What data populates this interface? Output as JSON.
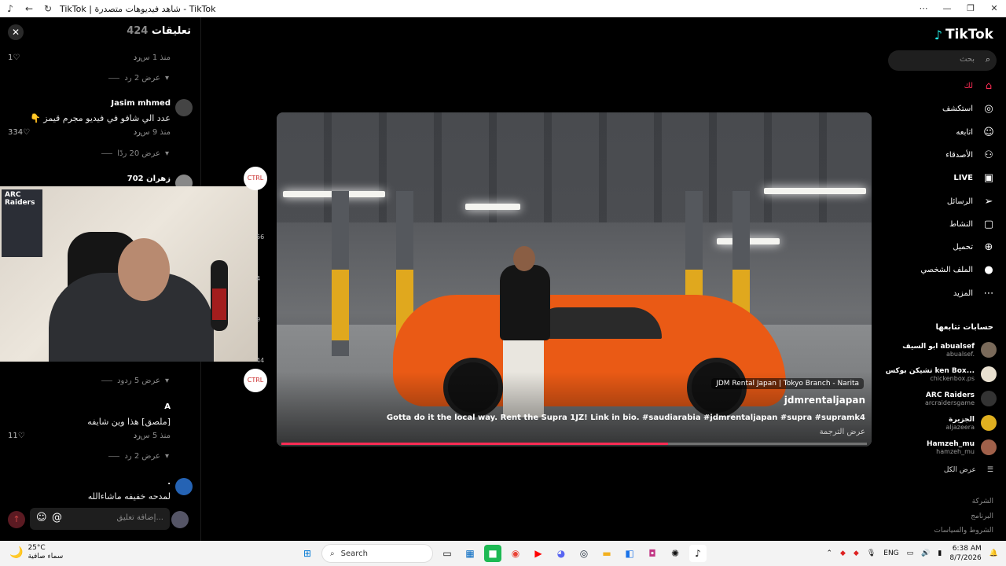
{
  "window": {
    "title": "TikTok | شاهد فيديوهات متصدرة - TikTok"
  },
  "comments": {
    "header_label": "تعليقات",
    "header_count": "424",
    "items": [
      {
        "meta": "منذ 1 س",
        "reply": "رد",
        "likes": "1"
      },
      {
        "replies_toggle": "عرض 2 رد"
      },
      {
        "name": "Jasim mhmed",
        "text": "عدد الي شافو في فيديو مجرم قيمز 👇",
        "meta": "منذ 9 س",
        "reply": "رد",
        "likes": "334"
      },
      {
        "replies_toggle": "عرض 20 ردًا"
      },
      {
        "name": "زهران 702"
      },
      {
        "replies_toggle": "عرض 5 ردود"
      },
      {
        "name": "A",
        "text": "[ملصق] هذا وين شايفه",
        "meta": "منذ 5 س",
        "reply": "رد",
        "likes": "11"
      },
      {
        "replies_toggle": "عرض 2 رد"
      },
      {
        "name": ".",
        "text": "لمدحه خفيفه ماشاءالله"
      }
    ],
    "input_placeholder": "إضافة تعليق...",
    "send_icon": "up-arrow-icon"
  },
  "webcam": {
    "poster_text": "ARC Raiders"
  },
  "side_actions": [
    "56",
    "4",
    "9",
    "44"
  ],
  "video": {
    "brand_tag": "JDM Rental Japan | Tokyo Branch - Narita",
    "author": "jdmrentaljapan",
    "description": "Gotta do it the local way. Rent the Supra 1JZ! Link in bio. #saudiarabia #jdmrentaljapan #supra #supramk4",
    "translate": "عرض الترجمة",
    "progress": 0.66
  },
  "nav": {
    "logo": "TikTok",
    "search_placeholder": "بحث",
    "items": [
      {
        "label": "لك",
        "icon": "home-icon",
        "active": true
      },
      {
        "label": "استكشف",
        "icon": "compass-icon"
      },
      {
        "label": "اتابعه",
        "icon": "user-follow-icon"
      },
      {
        "label": "الأصدقاء",
        "icon": "friends-icon"
      },
      {
        "label": "LIVE",
        "icon": "live-icon"
      },
      {
        "label": "الرسائل",
        "icon": "messages-icon"
      },
      {
        "label": "النشاط",
        "icon": "activity-icon"
      },
      {
        "label": "تحميل",
        "icon": "upload-icon"
      },
      {
        "label": "الملف الشخصي",
        "icon": "profile-avatar-icon"
      },
      {
        "label": "المزيد",
        "icon": "more-icon"
      }
    ],
    "following_title": "حسابات تتابعها",
    "following": [
      {
        "name": "ابو السيف abualsef",
        "handle": "abualsef."
      },
      {
        "name": "تشيكن بوكس ken Box...",
        "handle": "chickenbox.ps"
      },
      {
        "name": "ARC Raiders",
        "handle": "arcraidersgame"
      },
      {
        "name": "الجزيرة",
        "handle": "aljazeera"
      },
      {
        "name": "Hamzeh_mu",
        "handle": "hamzeh_mu"
      }
    ],
    "see_all": "عرض الكل",
    "footer": [
      "الشركة",
      "البرنامج",
      "الشروط والسياسات"
    ]
  },
  "taskbar": {
    "temp": "25°C",
    "weather": "سماء صافية",
    "search": "Search",
    "lang": "ENG",
    "time": "6:38 AM",
    "date": "8/7/2026"
  },
  "colors": {
    "accent": "#fe2c55",
    "cyan": "#25f4ee"
  }
}
